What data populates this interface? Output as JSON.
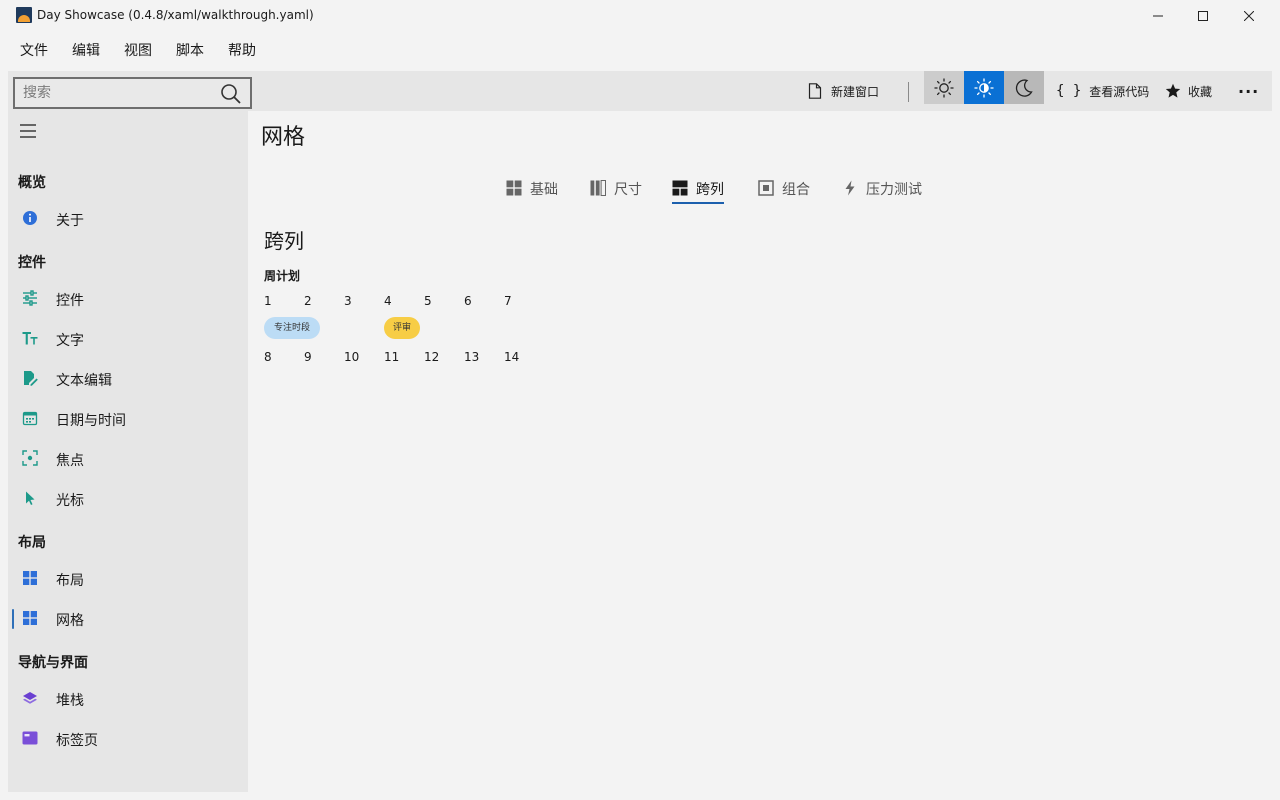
{
  "window": {
    "title": "Day Showcase (0.4.8/xaml/walkthrough.yaml)",
    "minimize": "—",
    "maximize": "☐",
    "close": "✕"
  },
  "menu": [
    "文件",
    "编辑",
    "视图",
    "脚本",
    "帮助"
  ],
  "search": {
    "placeholder": "搜索",
    "value": ""
  },
  "toolbar": {
    "new_window": "新建窗口",
    "view_source": "查看源代码",
    "favorite": "收藏",
    "more": "···",
    "theme_active": "auto"
  },
  "sidebar": {
    "sections": [
      {
        "header": "概览",
        "items": [
          {
            "label": "关于",
            "icon": "info-icon",
            "color": "#2e6fd8"
          }
        ]
      },
      {
        "header": "控件",
        "items": [
          {
            "label": "控件",
            "icon": "sliders-icon",
            "color": "#1d9a8a"
          },
          {
            "label": "文字",
            "icon": "text-size-icon",
            "color": "#1d9a8a"
          },
          {
            "label": "文本编辑",
            "icon": "edit-document-icon",
            "color": "#1d9a8a"
          },
          {
            "label": "日期与时间",
            "icon": "calendar-icon",
            "color": "#1d9a8a"
          },
          {
            "label": "焦点",
            "icon": "focus-icon",
            "color": "#1d9a8a"
          },
          {
            "label": "光标",
            "icon": "cursor-icon",
            "color": "#1d9a8a"
          }
        ]
      },
      {
        "header": "布局",
        "items": [
          {
            "label": "布局",
            "icon": "grid-icon",
            "color": "#2e6fd8"
          },
          {
            "label": "网格",
            "icon": "grid-icon",
            "color": "#2e6fd8",
            "active": true
          }
        ]
      },
      {
        "header": "导航与界面",
        "items": [
          {
            "label": "堆栈",
            "icon": "layers-icon",
            "color": "#6a3fd1"
          },
          {
            "label": "标签页",
            "icon": "tab-page-icon",
            "color": "#7a4fd8"
          }
        ]
      }
    ]
  },
  "main": {
    "title": "网格",
    "tabs": [
      {
        "label": "基础",
        "icon": "grid-icon"
      },
      {
        "label": "尺寸",
        "icon": "columns-icon"
      },
      {
        "label": "跨列",
        "icon": "span-icon",
        "active": true
      },
      {
        "label": "组合",
        "icon": "nested-icon"
      },
      {
        "label": "压力测试",
        "icon": "lightning-icon"
      }
    ],
    "section_title": "跨列",
    "subtitle": "周计划",
    "week1": [
      "1",
      "2",
      "3",
      "4",
      "5",
      "6",
      "7"
    ],
    "week2": [
      "8",
      "9",
      "10",
      "11",
      "12",
      "13",
      "14"
    ],
    "events": [
      {
        "label": "专注时段",
        "color": "#bcdcf5"
      },
      {
        "label": "评审",
        "color": "#f7cd45"
      }
    ]
  }
}
